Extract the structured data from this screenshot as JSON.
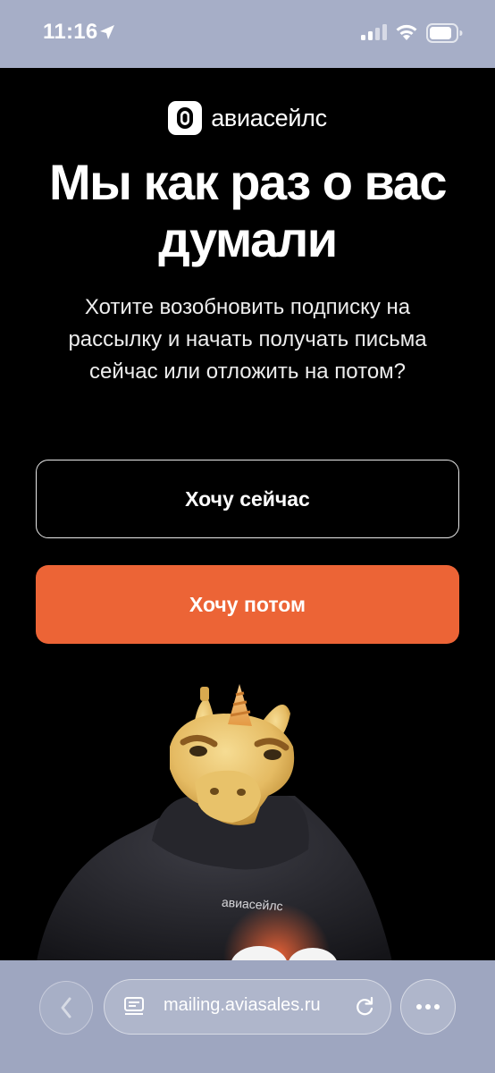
{
  "status_bar": {
    "time": "11:16",
    "icons": [
      "location-arrow-icon",
      "cellular-signal-icon",
      "wifi-icon",
      "battery-icon"
    ]
  },
  "brand": {
    "logo_text": "авиасейлс",
    "icon": "aviasales-logo-icon"
  },
  "main": {
    "title": "Мы как раз о вас думали",
    "subtitle": "Хотите возобновить подписку на рассылку и начать получать письма сейчас или отложить на потом?",
    "button_now_label": "Хочу сейчас",
    "button_later_label": "Хочу потом",
    "illustration": "unicorn-mascot-in-hoodie",
    "hoodie_text": "авиасейлс"
  },
  "browser": {
    "url": "mailing.aviasales.ru",
    "icons": [
      "back-chevron-icon",
      "page-menu-icon",
      "reload-icon",
      "more-icon"
    ]
  },
  "colors": {
    "background": "#000000",
    "accent": "#EC6436",
    "status_bar": "#A6AEC7",
    "toolbar": "#9EA6C0",
    "mascot_skin": "#E8C26A"
  }
}
